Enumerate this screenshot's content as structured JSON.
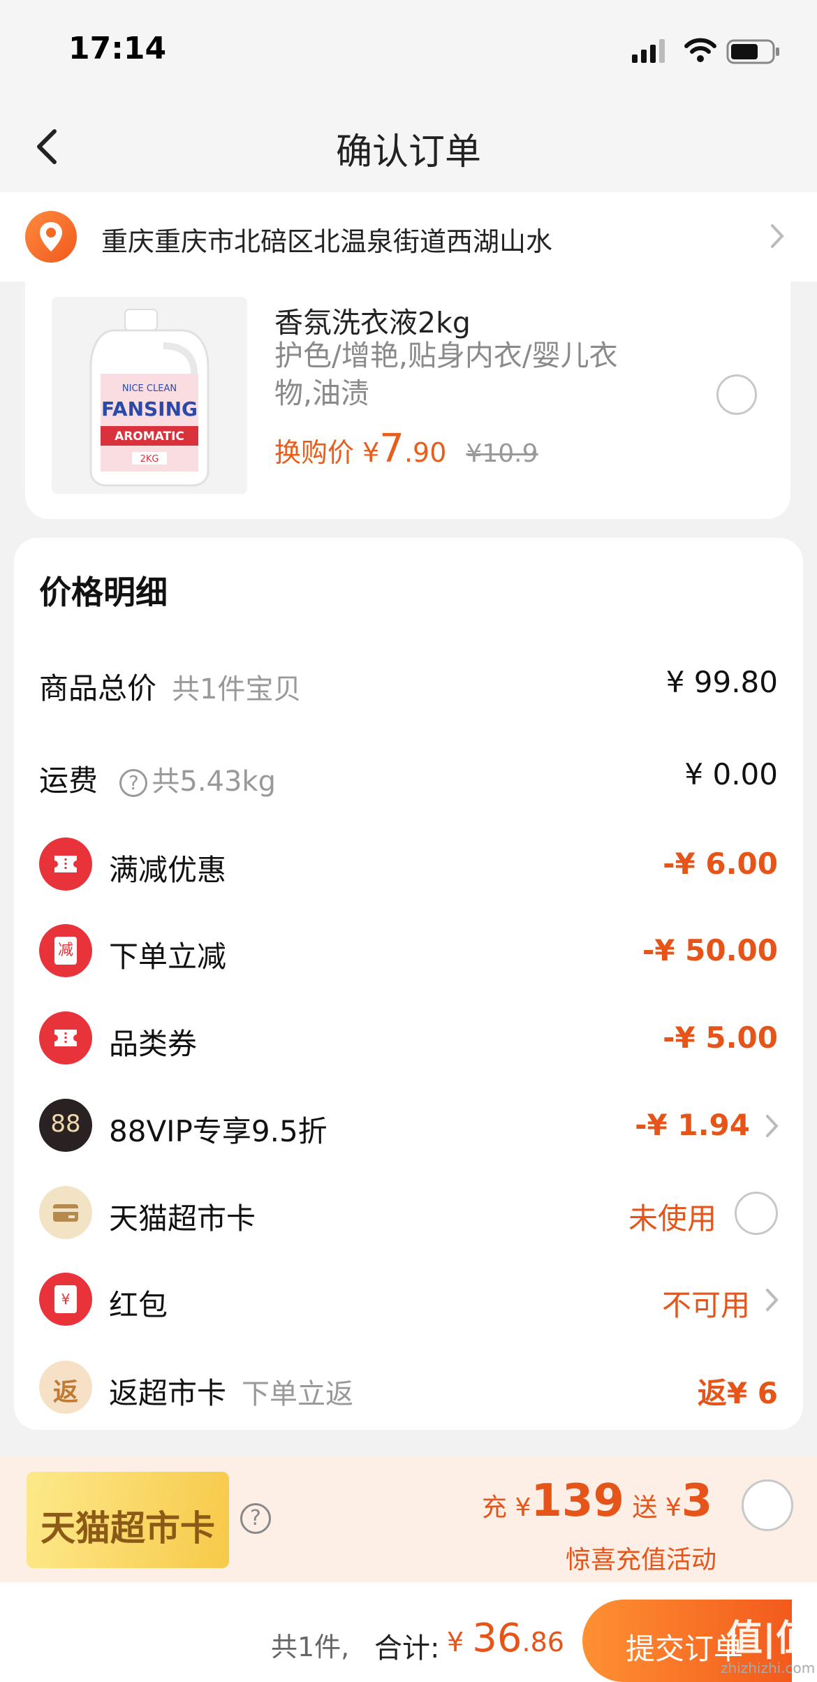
{
  "status_bar": {
    "time": "17:14"
  },
  "nav": {
    "title": "确认订单"
  },
  "address": {
    "text": "重庆重庆市北碚区北温泉街道西湖山水"
  },
  "product": {
    "name": "香氛洗衣液2kg",
    "desc": "护色/增艳,贴身内衣/婴儿衣物,油渍",
    "price_label": "换购价",
    "currency": "¥",
    "price_int": "7",
    "price_dec": ".90",
    "old_price": "¥10.9",
    "bottle_label_1": "NICE CLEAN",
    "bottle_label_2": "FANSING",
    "bottle_label_3": "AROMATIC",
    "bottle_label_4": "2KG"
  },
  "price_detail": {
    "title": "价格明细",
    "rows": [
      {
        "label": "商品总价",
        "sub": "共1件宝贝",
        "value": "¥ 99.80"
      },
      {
        "label": "运费",
        "sub": "共5.43kg",
        "help": "?",
        "value": "¥ 0.00"
      },
      {
        "label": "满减优惠",
        "value": "-¥ 6.00"
      },
      {
        "label": "下单立减",
        "icon_text": "减",
        "value": "-¥ 50.00"
      },
      {
        "label": "品类券",
        "value": "-¥ 5.00"
      },
      {
        "label": "88VIP专享9.5折",
        "icon_text": "88",
        "value": "-¥ 1.94"
      },
      {
        "label": "天猫超市卡",
        "value": "未使用"
      },
      {
        "label": "红包",
        "icon_text": "¥",
        "value": "不可用"
      },
      {
        "label": "返超市卡",
        "icon_text": "返",
        "sub": "下单立返",
        "value": "返¥ 6"
      }
    ]
  },
  "promo": {
    "card_text": "天猫超市卡",
    "help": "?",
    "recharge_label": "充",
    "recharge_currency": "¥",
    "recharge_amount": "139",
    "bonus_label": "送",
    "bonus_currency": "¥",
    "bonus_amount": "3",
    "subtitle": "惊喜充值活动"
  },
  "footer": {
    "count": "共1件,",
    "total_label": "合计:",
    "currency": "¥",
    "total_int": "36",
    "total_dec": ".86",
    "submit_label": "提交订单",
    "watermark": "值|值",
    "watermark_url": "zhizhizhi.com"
  },
  "colors": {
    "accent": "#e5551a",
    "red_icon": "#e8333a",
    "vip_icon": "#2a2222",
    "card_icon": "#f2e3c4"
  }
}
